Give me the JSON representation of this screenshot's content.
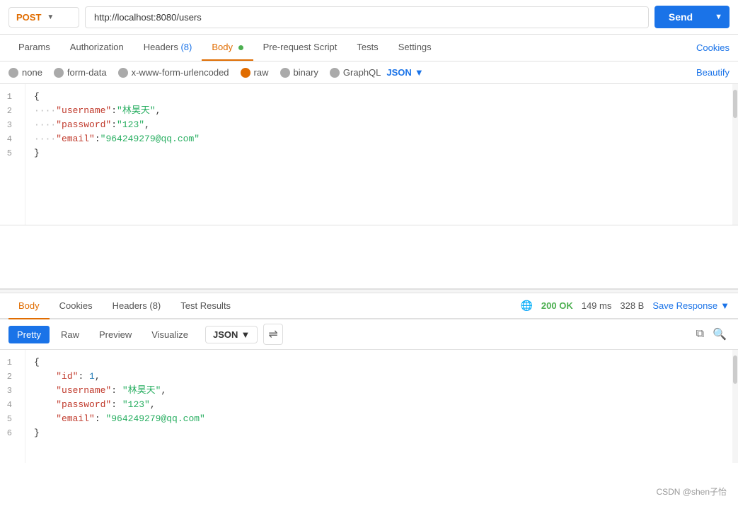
{
  "topbar": {
    "method": "POST",
    "url": "http://localhost:8080/users",
    "send_label": "Send"
  },
  "request_tabs": [
    {
      "label": "Params",
      "active": false
    },
    {
      "label": "Authorization",
      "active": false
    },
    {
      "label": "Headers",
      "badge": "(8)",
      "active": false
    },
    {
      "label": "Body",
      "dot": true,
      "active": true
    },
    {
      "label": "Pre-request Script",
      "active": false
    },
    {
      "label": "Tests",
      "active": false
    },
    {
      "label": "Settings",
      "active": false
    }
  ],
  "cookies_link": "Cookies",
  "body_types": [
    {
      "label": "none",
      "active": false
    },
    {
      "label": "form-data",
      "active": false
    },
    {
      "label": "x-www-form-urlencoded",
      "active": false
    },
    {
      "label": "raw",
      "active": true
    },
    {
      "label": "binary",
      "active": false
    },
    {
      "label": "GraphQL",
      "active": false
    }
  ],
  "json_format": "JSON",
  "beautify_label": "Beautify",
  "request_body_lines": [
    {
      "num": 1,
      "content": "{"
    },
    {
      "num": 2,
      "content": "    \"username\":\"林昊天\","
    },
    {
      "num": 3,
      "content": "    \"password\":\"123\","
    },
    {
      "num": 4,
      "content": "    \"email\":\"964249279@qq.com\""
    },
    {
      "num": 5,
      "content": "}"
    }
  ],
  "response_tabs": [
    {
      "label": "Body",
      "active": true
    },
    {
      "label": "Cookies",
      "active": false
    },
    {
      "label": "Headers",
      "badge": "(8)",
      "active": false
    },
    {
      "label": "Test Results",
      "active": false
    }
  ],
  "response_meta": {
    "status": "200 OK",
    "time": "149 ms",
    "size": "328 B"
  },
  "save_response_label": "Save Response",
  "view_tabs": [
    {
      "label": "Pretty",
      "active": true
    },
    {
      "label": "Raw",
      "active": false
    },
    {
      "label": "Preview",
      "active": false
    },
    {
      "label": "Visualize",
      "active": false
    }
  ],
  "resp_json_format": "JSON",
  "response_body_lines": [
    {
      "num": 1,
      "content": "{"
    },
    {
      "num": 2,
      "content": "    \"id\": 1,"
    },
    {
      "num": 3,
      "content": "    \"username\": \"林昊天\","
    },
    {
      "num": 4,
      "content": "    \"password\": \"123\","
    },
    {
      "num": 5,
      "content": "    \"email\": \"964249279@qq.com\""
    },
    {
      "num": 6,
      "content": "}"
    }
  ],
  "watermark": "CSDN @shen子怡"
}
